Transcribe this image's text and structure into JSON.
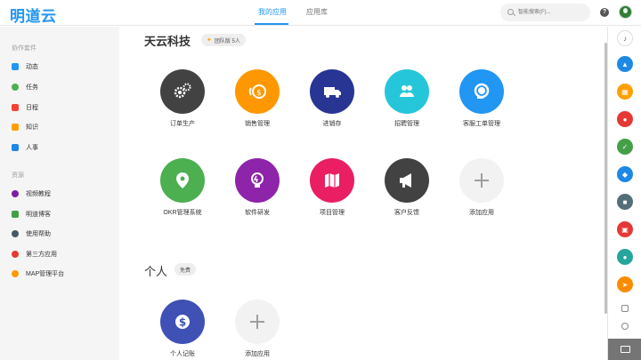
{
  "header": {
    "logo": "明道云",
    "tabs": [
      {
        "label": "我的应用",
        "active": true
      },
      {
        "label": "应用库",
        "active": false
      }
    ],
    "search_placeholder": "智能搜索(F)...",
    "help": "?"
  },
  "sidebar": {
    "sections": [
      {
        "title": "协作套件",
        "items": [
          {
            "label": "动态",
            "icon": "feed-icon",
            "color": "#2196f3"
          },
          {
            "label": "任务",
            "icon": "task-icon",
            "color": "#4caf50"
          },
          {
            "label": "日程",
            "icon": "calendar-icon",
            "color": "#f44336"
          },
          {
            "label": "知识",
            "icon": "folder-icon",
            "color": "#ffa000"
          },
          {
            "label": "人事",
            "icon": "hr-icon",
            "color": "#1e88e5"
          }
        ]
      },
      {
        "title": "资源",
        "items": [
          {
            "label": "视频教程",
            "icon": "video-icon",
            "color": "#7b1fa2"
          },
          {
            "label": "明道博客",
            "icon": "blog-icon",
            "color": "#43a047"
          },
          {
            "label": "使用帮助",
            "icon": "help-icon",
            "color": "#455a64"
          },
          {
            "label": "第三方应用",
            "icon": "heart-icon",
            "color": "#e53935"
          },
          {
            "label": "MAP管理平台",
            "icon": "map-icon",
            "color": "#ff9800"
          }
        ]
      }
    ]
  },
  "groups": [
    {
      "title": "天云科技",
      "badge": "团队版 5人",
      "apps": [
        {
          "label": "订单生产",
          "icon": "gears-icon",
          "color": "#424242"
        },
        {
          "label": "销售管理",
          "icon": "coins-icon",
          "color": "#ff9800"
        },
        {
          "label": "进销存",
          "icon": "truck-icon",
          "color": "#283593"
        },
        {
          "label": "招聘管理",
          "icon": "people-icon",
          "color": "#26c6da"
        },
        {
          "label": "客服工单管理",
          "icon": "headset-icon",
          "color": "#2196f3"
        },
        {
          "label": "OKR管理系统",
          "icon": "location-icon",
          "color": "#4caf50"
        },
        {
          "label": "软件研发",
          "icon": "bulb-icon",
          "color": "#8e24aa"
        },
        {
          "label": "项目管理",
          "icon": "map-fold-icon",
          "color": "#e91e63"
        },
        {
          "label": "客户反馈",
          "icon": "megaphone-icon",
          "color": "#424242"
        },
        {
          "label": "添加应用",
          "icon": "plus-icon",
          "color": "#f2f2f2"
        }
      ]
    },
    {
      "title": "个人",
      "badge": "免费",
      "apps": [
        {
          "label": "个人记账",
          "icon": "dollar-icon",
          "color": "#3f51b5"
        },
        {
          "label": "添加应用",
          "icon": "plus-icon",
          "color": "#f2f2f2"
        }
      ]
    }
  ],
  "rail": [
    {
      "icon": "bell-icon",
      "color": "#ffffff"
    },
    {
      "icon": "org-icon",
      "color": "#1e88e5"
    },
    {
      "icon": "grid-icon",
      "color": "#ffa000"
    },
    {
      "icon": "team-icon",
      "color": "#e53935"
    },
    {
      "icon": "check-icon",
      "color": "#43a047"
    },
    {
      "icon": "notify-icon",
      "color": "#1e88e5"
    },
    {
      "icon": "briefcase-icon",
      "color": "#546e7a"
    },
    {
      "icon": "calendar-icon",
      "color": "#e53935"
    },
    {
      "icon": "group-icon",
      "color": "#26a69a"
    },
    {
      "icon": "send-icon",
      "color": "#fb8c00"
    }
  ]
}
